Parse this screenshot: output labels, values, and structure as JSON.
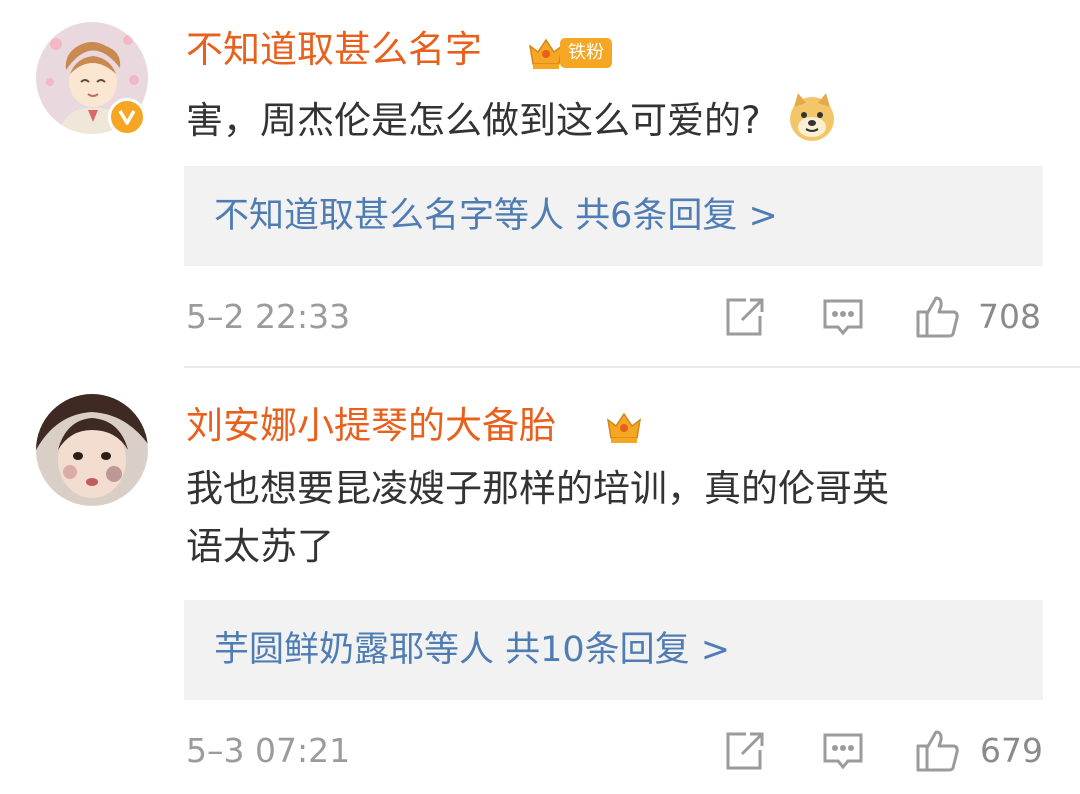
{
  "comments": [
    {
      "username": "不知道取甚么名字",
      "fan_badge": "铁粉",
      "text": "害，周杰伦是怎么做到这么可爱的?",
      "emoji_icon": "doge-emoji-icon",
      "reply_summary": "不知道取甚么名字等人  共6条回复 >",
      "timestamp": "5–2 22:33",
      "likes": "708",
      "verified": true
    },
    {
      "username": "刘安娜小提琴的大备胎",
      "text_lines": [
        "我也想要昆凌嫂子那样的培训，真的伦哥英",
        "语太苏了"
      ],
      "reply_summary": "芋圆鲜奶露耶等人  共10条回复 >",
      "timestamp": "5–3 07:21",
      "likes": "679",
      "verified": false
    }
  ],
  "colors": {
    "username": "#e8601c",
    "reply_link": "#4f7db3",
    "meta": "#9b9b9b",
    "reply_bg": "#f2f2f2",
    "crown": "#f5a623"
  },
  "icons": [
    "share-icon",
    "comment-icon",
    "thumbs-up-icon",
    "crown-badge-icon",
    "verified-v-icon"
  ]
}
